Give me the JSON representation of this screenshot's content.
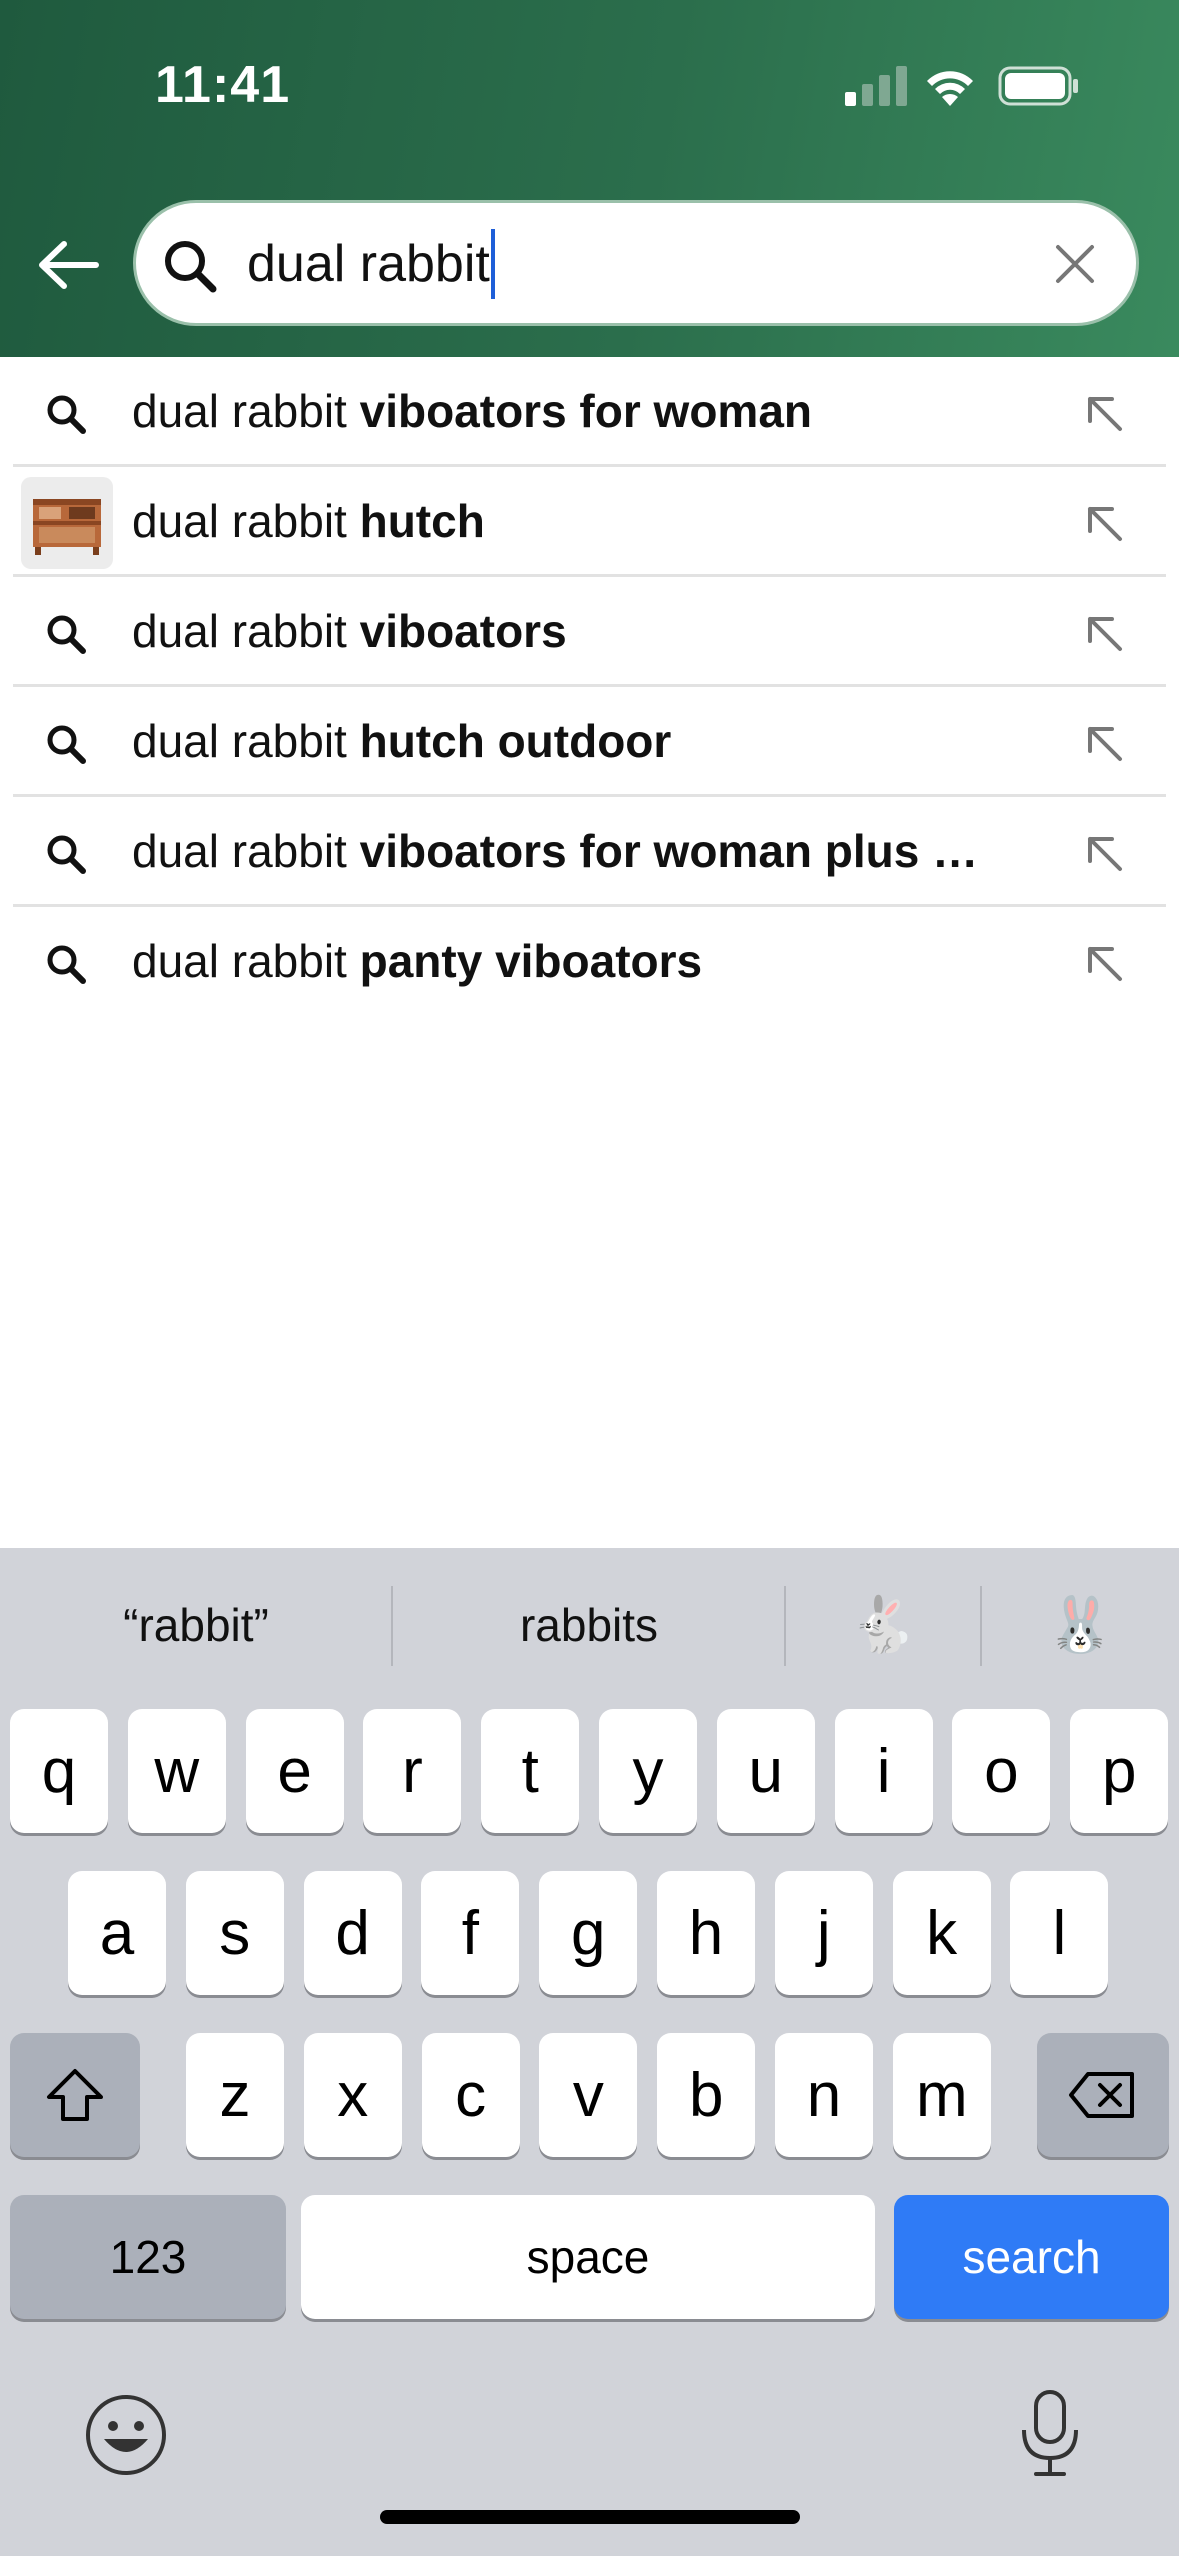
{
  "status_bar": {
    "time": "11:41"
  },
  "header": {
    "background_color": "#2b6e4c",
    "back_icon": "arrow-left-icon",
    "search_query": "dual rabbit",
    "clear_icon": "x-close-icon"
  },
  "suggestions": [
    {
      "prefix": "dual rabbit ",
      "completion": "viboators for woman",
      "icon": "search-icon"
    },
    {
      "prefix": "dual rabbit ",
      "completion": "hutch",
      "icon": "product-thumbnail"
    },
    {
      "prefix": "dual rabbit ",
      "completion": "viboators",
      "icon": "search-icon"
    },
    {
      "prefix": "dual rabbit ",
      "completion": "hutch outdoor",
      "icon": "search-icon"
    },
    {
      "prefix": "dual rabbit ",
      "completion": "viboators for woman plus …",
      "icon": "search-icon"
    },
    {
      "prefix": "dual rabbit ",
      "completion": "panty viboators",
      "icon": "search-icon"
    }
  ],
  "keyboard": {
    "predictions": [
      "“rabbit”",
      "rabbits",
      "🐇",
      "🐰"
    ],
    "row1": [
      "q",
      "w",
      "e",
      "r",
      "t",
      "y",
      "u",
      "i",
      "o",
      "p"
    ],
    "row2": [
      "a",
      "s",
      "d",
      "f",
      "g",
      "h",
      "j",
      "k",
      "l"
    ],
    "row3": [
      "z",
      "x",
      "c",
      "v",
      "b",
      "n",
      "m"
    ],
    "numbers_label": "123",
    "space_label": "space",
    "search_label": "search",
    "search_key_color": "#2f7bf6"
  }
}
